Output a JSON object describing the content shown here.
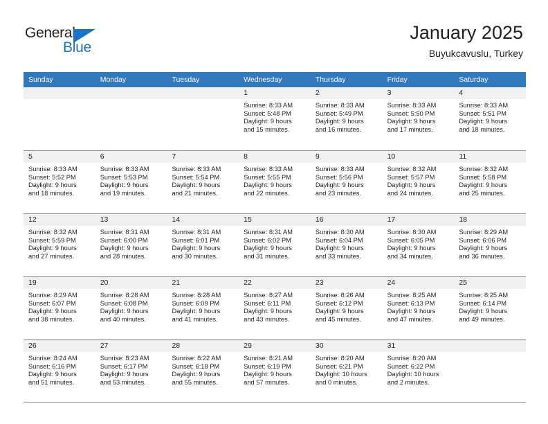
{
  "brand": {
    "name_part1": "General",
    "name_part2": "Blue",
    "triangle_icon": "triangle-icon",
    "color_primary": "#1f72bd",
    "color_text": "#231f20"
  },
  "header": {
    "title": "January 2025",
    "subtitle": "Buyukcavuslu, Turkey"
  },
  "calendar": {
    "header_background": "#3179bc",
    "daynum_background": "#f0f0f0",
    "weekdays": [
      "Sunday",
      "Monday",
      "Tuesday",
      "Wednesday",
      "Thursday",
      "Friday",
      "Saturday"
    ],
    "weeks": [
      [
        {
          "day": "",
          "empty": true,
          "sunrise": "",
          "sunset": "",
          "daylight_line1": "",
          "daylight_line2": ""
        },
        {
          "day": "",
          "empty": true,
          "sunrise": "",
          "sunset": "",
          "daylight_line1": "",
          "daylight_line2": ""
        },
        {
          "day": "",
          "empty": true,
          "sunrise": "",
          "sunset": "",
          "daylight_line1": "",
          "daylight_line2": ""
        },
        {
          "day": "1",
          "empty": false,
          "sunrise": "Sunrise: 8:33 AM",
          "sunset": "Sunset: 5:48 PM",
          "daylight_line1": "Daylight: 9 hours",
          "daylight_line2": "and 15 minutes."
        },
        {
          "day": "2",
          "empty": false,
          "sunrise": "Sunrise: 8:33 AM",
          "sunset": "Sunset: 5:49 PM",
          "daylight_line1": "Daylight: 9 hours",
          "daylight_line2": "and 16 minutes."
        },
        {
          "day": "3",
          "empty": false,
          "sunrise": "Sunrise: 8:33 AM",
          "sunset": "Sunset: 5:50 PM",
          "daylight_line1": "Daylight: 9 hours",
          "daylight_line2": "and 17 minutes."
        },
        {
          "day": "4",
          "empty": false,
          "sunrise": "Sunrise: 8:33 AM",
          "sunset": "Sunset: 5:51 PM",
          "daylight_line1": "Daylight: 9 hours",
          "daylight_line2": "and 18 minutes."
        }
      ],
      [
        {
          "day": "5",
          "empty": false,
          "sunrise": "Sunrise: 8:33 AM",
          "sunset": "Sunset: 5:52 PM",
          "daylight_line1": "Daylight: 9 hours",
          "daylight_line2": "and 18 minutes."
        },
        {
          "day": "6",
          "empty": false,
          "sunrise": "Sunrise: 8:33 AM",
          "sunset": "Sunset: 5:53 PM",
          "daylight_line1": "Daylight: 9 hours",
          "daylight_line2": "and 19 minutes."
        },
        {
          "day": "7",
          "empty": false,
          "sunrise": "Sunrise: 8:33 AM",
          "sunset": "Sunset: 5:54 PM",
          "daylight_line1": "Daylight: 9 hours",
          "daylight_line2": "and 21 minutes."
        },
        {
          "day": "8",
          "empty": false,
          "sunrise": "Sunrise: 8:33 AM",
          "sunset": "Sunset: 5:55 PM",
          "daylight_line1": "Daylight: 9 hours",
          "daylight_line2": "and 22 minutes."
        },
        {
          "day": "9",
          "empty": false,
          "sunrise": "Sunrise: 8:33 AM",
          "sunset": "Sunset: 5:56 PM",
          "daylight_line1": "Daylight: 9 hours",
          "daylight_line2": "and 23 minutes."
        },
        {
          "day": "10",
          "empty": false,
          "sunrise": "Sunrise: 8:32 AM",
          "sunset": "Sunset: 5:57 PM",
          "daylight_line1": "Daylight: 9 hours",
          "daylight_line2": "and 24 minutes."
        },
        {
          "day": "11",
          "empty": false,
          "sunrise": "Sunrise: 8:32 AM",
          "sunset": "Sunset: 5:58 PM",
          "daylight_line1": "Daylight: 9 hours",
          "daylight_line2": "and 25 minutes."
        }
      ],
      [
        {
          "day": "12",
          "empty": false,
          "sunrise": "Sunrise: 8:32 AM",
          "sunset": "Sunset: 5:59 PM",
          "daylight_line1": "Daylight: 9 hours",
          "daylight_line2": "and 27 minutes."
        },
        {
          "day": "13",
          "empty": false,
          "sunrise": "Sunrise: 8:31 AM",
          "sunset": "Sunset: 6:00 PM",
          "daylight_line1": "Daylight: 9 hours",
          "daylight_line2": "and 28 minutes."
        },
        {
          "day": "14",
          "empty": false,
          "sunrise": "Sunrise: 8:31 AM",
          "sunset": "Sunset: 6:01 PM",
          "daylight_line1": "Daylight: 9 hours",
          "daylight_line2": "and 30 minutes."
        },
        {
          "day": "15",
          "empty": false,
          "sunrise": "Sunrise: 8:31 AM",
          "sunset": "Sunset: 6:02 PM",
          "daylight_line1": "Daylight: 9 hours",
          "daylight_line2": "and 31 minutes."
        },
        {
          "day": "16",
          "empty": false,
          "sunrise": "Sunrise: 8:30 AM",
          "sunset": "Sunset: 6:04 PM",
          "daylight_line1": "Daylight: 9 hours",
          "daylight_line2": "and 33 minutes."
        },
        {
          "day": "17",
          "empty": false,
          "sunrise": "Sunrise: 8:30 AM",
          "sunset": "Sunset: 6:05 PM",
          "daylight_line1": "Daylight: 9 hours",
          "daylight_line2": "and 34 minutes."
        },
        {
          "day": "18",
          "empty": false,
          "sunrise": "Sunrise: 8:29 AM",
          "sunset": "Sunset: 6:06 PM",
          "daylight_line1": "Daylight: 9 hours",
          "daylight_line2": "and 36 minutes."
        }
      ],
      [
        {
          "day": "19",
          "empty": false,
          "sunrise": "Sunrise: 8:29 AM",
          "sunset": "Sunset: 6:07 PM",
          "daylight_line1": "Daylight: 9 hours",
          "daylight_line2": "and 38 minutes."
        },
        {
          "day": "20",
          "empty": false,
          "sunrise": "Sunrise: 8:28 AM",
          "sunset": "Sunset: 6:08 PM",
          "daylight_line1": "Daylight: 9 hours",
          "daylight_line2": "and 40 minutes."
        },
        {
          "day": "21",
          "empty": false,
          "sunrise": "Sunrise: 8:28 AM",
          "sunset": "Sunset: 6:09 PM",
          "daylight_line1": "Daylight: 9 hours",
          "daylight_line2": "and 41 minutes."
        },
        {
          "day": "22",
          "empty": false,
          "sunrise": "Sunrise: 8:27 AM",
          "sunset": "Sunset: 6:11 PM",
          "daylight_line1": "Daylight: 9 hours",
          "daylight_line2": "and 43 minutes."
        },
        {
          "day": "23",
          "empty": false,
          "sunrise": "Sunrise: 8:26 AM",
          "sunset": "Sunset: 6:12 PM",
          "daylight_line1": "Daylight: 9 hours",
          "daylight_line2": "and 45 minutes."
        },
        {
          "day": "24",
          "empty": false,
          "sunrise": "Sunrise: 8:25 AM",
          "sunset": "Sunset: 6:13 PM",
          "daylight_line1": "Daylight: 9 hours",
          "daylight_line2": "and 47 minutes."
        },
        {
          "day": "25",
          "empty": false,
          "sunrise": "Sunrise: 8:25 AM",
          "sunset": "Sunset: 6:14 PM",
          "daylight_line1": "Daylight: 9 hours",
          "daylight_line2": "and 49 minutes."
        }
      ],
      [
        {
          "day": "26",
          "empty": false,
          "sunrise": "Sunrise: 8:24 AM",
          "sunset": "Sunset: 6:16 PM",
          "daylight_line1": "Daylight: 9 hours",
          "daylight_line2": "and 51 minutes."
        },
        {
          "day": "27",
          "empty": false,
          "sunrise": "Sunrise: 8:23 AM",
          "sunset": "Sunset: 6:17 PM",
          "daylight_line1": "Daylight: 9 hours",
          "daylight_line2": "and 53 minutes."
        },
        {
          "day": "28",
          "empty": false,
          "sunrise": "Sunrise: 8:22 AM",
          "sunset": "Sunset: 6:18 PM",
          "daylight_line1": "Daylight: 9 hours",
          "daylight_line2": "and 55 minutes."
        },
        {
          "day": "29",
          "empty": false,
          "sunrise": "Sunrise: 8:21 AM",
          "sunset": "Sunset: 6:19 PM",
          "daylight_line1": "Daylight: 9 hours",
          "daylight_line2": "and 57 minutes."
        },
        {
          "day": "30",
          "empty": false,
          "sunrise": "Sunrise: 8:20 AM",
          "sunset": "Sunset: 6:21 PM",
          "daylight_line1": "Daylight: 10 hours",
          "daylight_line2": "and 0 minutes."
        },
        {
          "day": "31",
          "empty": false,
          "sunrise": "Sunrise: 8:20 AM",
          "sunset": "Sunset: 6:22 PM",
          "daylight_line1": "Daylight: 10 hours",
          "daylight_line2": "and 2 minutes."
        },
        {
          "day": "",
          "empty": true,
          "sunrise": "",
          "sunset": "",
          "daylight_line1": "",
          "daylight_line2": ""
        }
      ]
    ]
  }
}
